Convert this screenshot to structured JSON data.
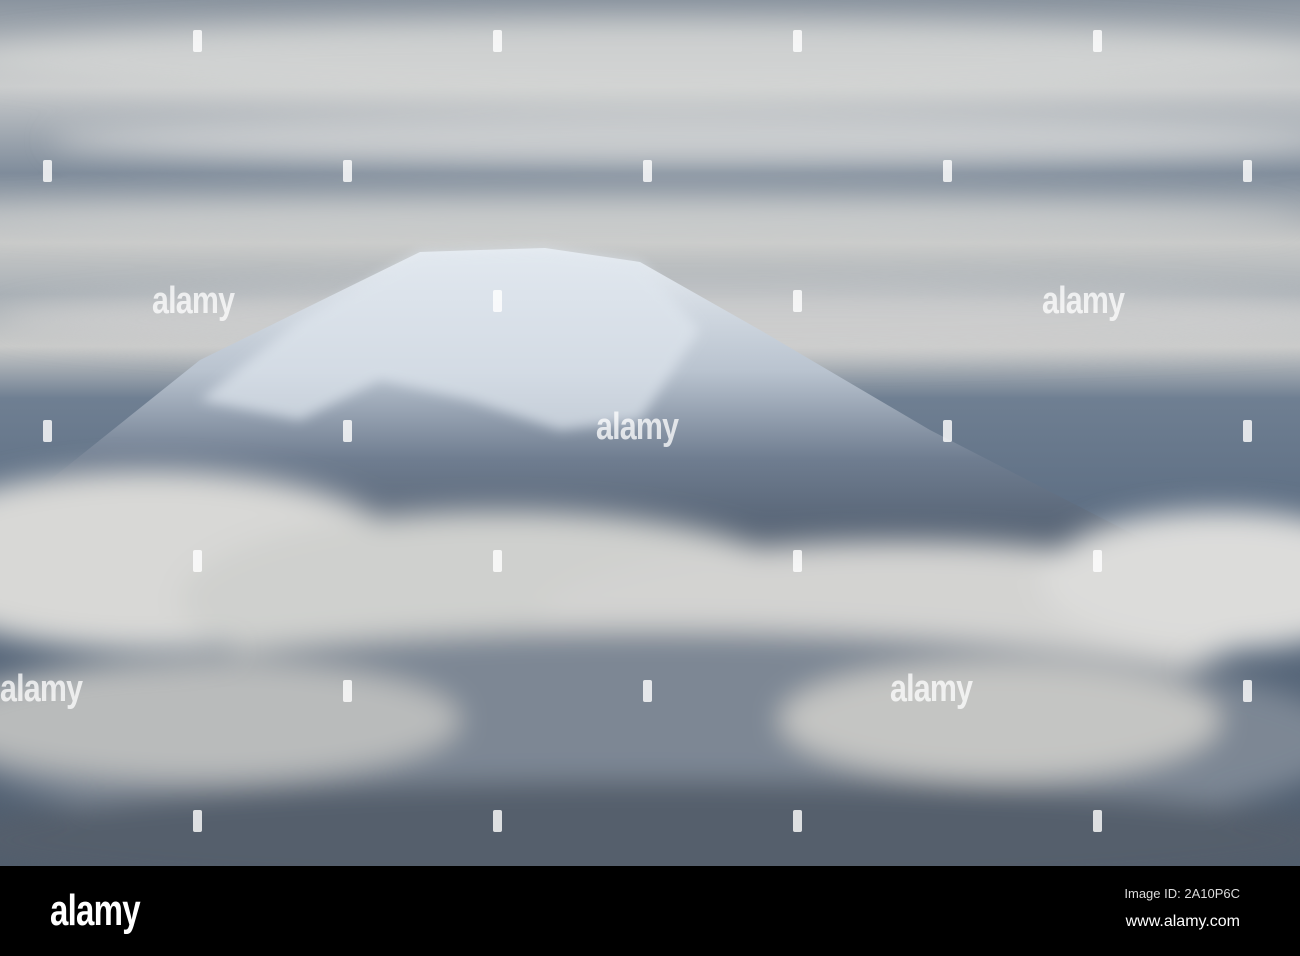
{
  "watermark": "alamy",
  "footer": {
    "logo": "alamy",
    "image_id": "Image ID: 2A10P6C",
    "url": "www.alamy.com"
  }
}
